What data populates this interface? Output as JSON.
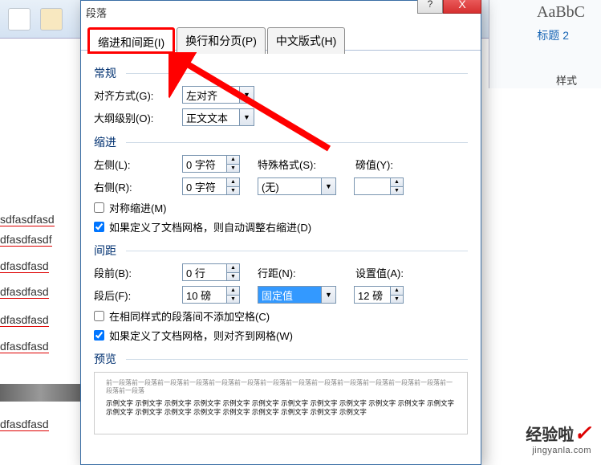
{
  "background": {
    "doc_lines": [
      "sdfasdfasd",
      "dfasdfasdf",
      "dfasdfasd",
      "dfasdfasd",
      "dfasdfasd",
      "dfasdfasd",
      "dfasdfasd"
    ],
    "style_preview": "AaBbC",
    "style_name": "标题 2",
    "style_footer": "样式"
  },
  "dialog": {
    "title": "段落",
    "tabs": {
      "indent_spacing": "缩进和间距(I)",
      "line_page": "换行和分页(P)",
      "chinese": "中文版式(H)"
    },
    "general": {
      "section": "常规",
      "align_label": "对齐方式(G):",
      "align_value": "左对齐",
      "outline_label": "大纲级别(O):",
      "outline_value": "正文文本"
    },
    "indent": {
      "section": "缩进",
      "left_label": "左侧(L):",
      "left_value": "0 字符",
      "right_label": "右侧(R):",
      "right_value": "0 字符",
      "special_label": "特殊格式(S):",
      "special_value": "(无)",
      "by_label": "磅值(Y):",
      "by_value": "",
      "mirror": "对称缩进(M)",
      "autogrid": "如果定义了文档网格，则自动调整右缩进(D)"
    },
    "spacing": {
      "section": "间距",
      "before_label": "段前(B):",
      "before_value": "0 行",
      "after_label": "段后(F):",
      "after_value": "10 磅",
      "line_label": "行距(N):",
      "line_value": "固定值",
      "at_label": "设置值(A):",
      "at_value": "12 磅",
      "no_space": "在相同样式的段落间不添加空格(C)",
      "snapgrid": "如果定义了文档网格，则对齐到网格(W)"
    },
    "preview": {
      "section": "预览",
      "filler_top": "前一段落前一段落前一段落前一段落前一段落前一段落前一段落前一段落前一段落前一段落前一段落前一段落前一段落前一段落前一段落",
      "filler_main": "示例文字 示例文字 示例文字 示例文字 示例文字 示例文字 示例文字 示例文字 示例文字 示例文字 示例文字 示例文字 示例文字 示例文字 示例文字 示例文字 示例文字 示例文字 示例文字 示例文字 示例文字"
    }
  },
  "watermark": {
    "main": "经验啦",
    "sub": "jingyanla.com"
  },
  "glyphs": {
    "down": "▼",
    "up": "▲",
    "help": "?",
    "close": "X"
  }
}
